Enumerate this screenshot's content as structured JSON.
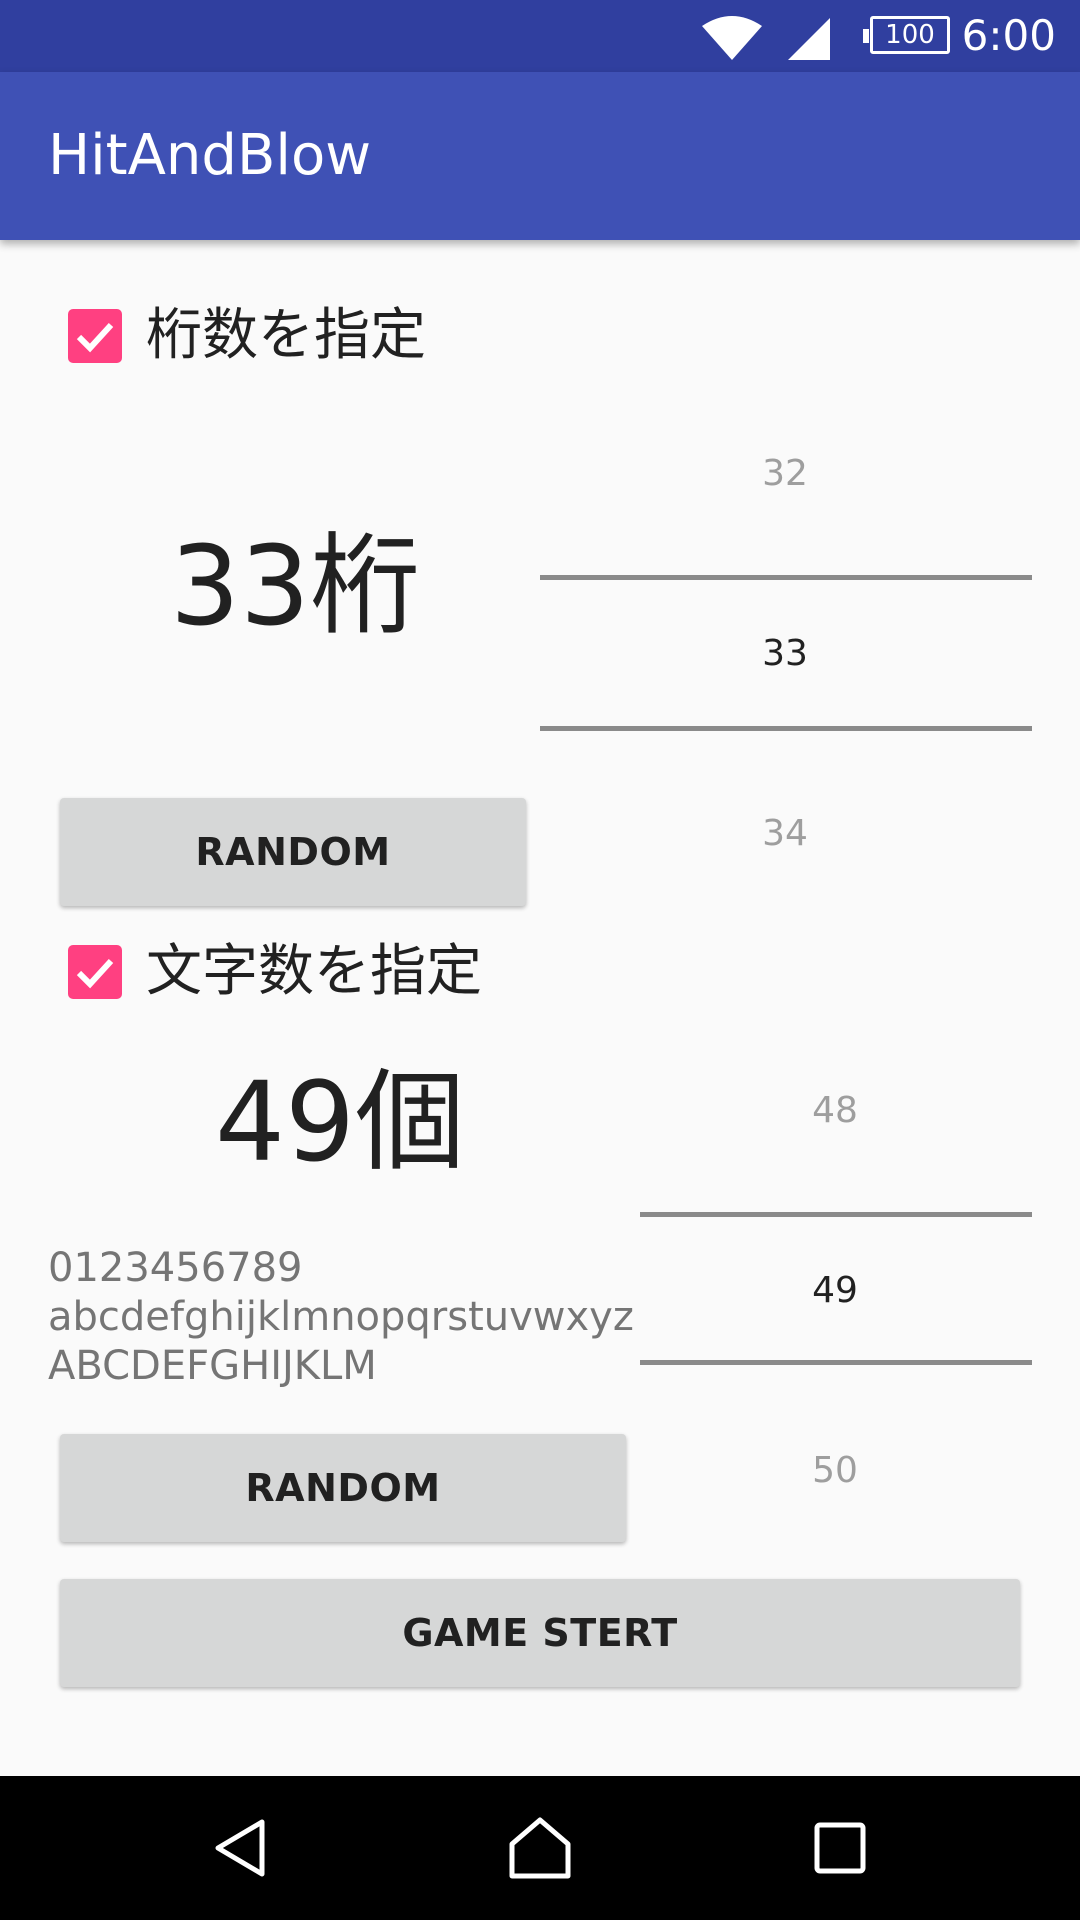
{
  "status_bar": {
    "time": "6:00",
    "battery_level": "100"
  },
  "app_bar": {
    "title": "HitAndBlow"
  },
  "digits_section": {
    "checkbox_label": "桁数を指定",
    "checked": true,
    "value_display": "33桁",
    "picker": {
      "prev": "32",
      "selected": "33",
      "next": "34"
    },
    "random_button": "RANDOM"
  },
  "chars_section": {
    "checkbox_label": "文字数を指定",
    "checked": true,
    "value_display": "49個",
    "charset_lines": [
      "0123456789",
      "abcdefghijklmnopqrstuvwxyz",
      "ABCDEFGHIJKLM"
    ],
    "picker": {
      "prev": "48",
      "selected": "49",
      "next": "50"
    },
    "random_button": "RANDOM"
  },
  "game_start_button": "GAME STERT",
  "colors": {
    "status_bar": "#303f9f",
    "app_bar": "#3f51b5",
    "accent": "#ff4081",
    "button": "#d6d7d7"
  },
  "nav_bar": {
    "icons": [
      "back-icon",
      "home-icon",
      "recents-icon"
    ]
  }
}
